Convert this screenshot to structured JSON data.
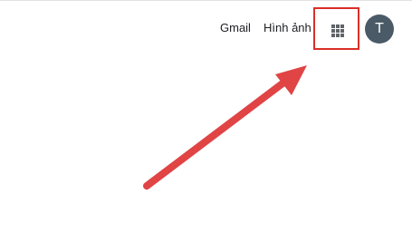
{
  "header": {
    "gmail_label": "Gmail",
    "images_label": "Hình ảnh",
    "apps_icon": "apps-grid-icon",
    "avatar_initial": "T"
  },
  "colors": {
    "avatar_bg": "#4a5a67",
    "highlight": "#d93025",
    "arrow": "#e04444",
    "icon": "#5f6368"
  }
}
